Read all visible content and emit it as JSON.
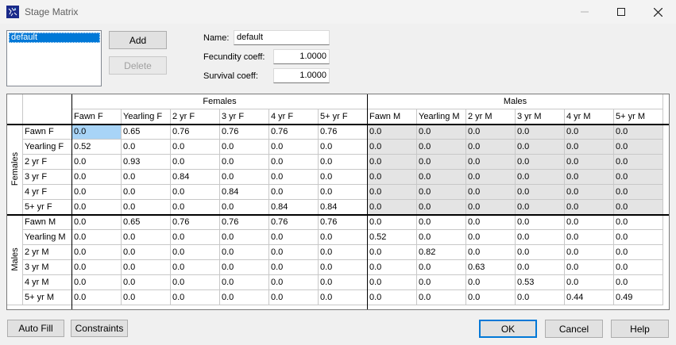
{
  "window": {
    "title": "Stage Matrix"
  },
  "stages_list": {
    "items": [
      "default"
    ]
  },
  "buttons": {
    "add": "Add",
    "delete": "Delete",
    "auto_fill": "Auto Fill",
    "constraints": "Constraints",
    "ok": "OK",
    "cancel": "Cancel",
    "help": "Help"
  },
  "fields": {
    "name_label": "Name:",
    "name_value": "default",
    "fecundity_label": "Fecundity coeff:",
    "fecundity_value": "1.0000",
    "survival_label": "Survival coeff:",
    "survival_value": "1.0000"
  },
  "matrix": {
    "group_headers": [
      "Females",
      "Males"
    ],
    "columns": [
      "Fawn F",
      "Yearling F",
      "2 yr F",
      "3 yr F",
      "4 yr F",
      "5+ yr F",
      "Fawn M",
      "Yearling M",
      "2 yr M",
      "3 yr M",
      "4 yr M",
      "5+ yr M"
    ],
    "row_groups": [
      "Females",
      "Males"
    ],
    "rows": [
      "Fawn F",
      "Yearling F",
      "2 yr F",
      "3 yr F",
      "4 yr F",
      "5+ yr F",
      "Fawn M",
      "Yearling M",
      "2 yr M",
      "3 yr M",
      "4 yr M",
      "5+ yr M"
    ],
    "values": [
      [
        "0.0",
        "0.65",
        "0.76",
        "0.76",
        "0.76",
        "0.76",
        "0.0",
        "0.0",
        "0.0",
        "0.0",
        "0.0",
        "0.0"
      ],
      [
        "0.52",
        "0.0",
        "0.0",
        "0.0",
        "0.0",
        "0.0",
        "0.0",
        "0.0",
        "0.0",
        "0.0",
        "0.0",
        "0.0"
      ],
      [
        "0.0",
        "0.93",
        "0.0",
        "0.0",
        "0.0",
        "0.0",
        "0.0",
        "0.0",
        "0.0",
        "0.0",
        "0.0",
        "0.0"
      ],
      [
        "0.0",
        "0.0",
        "0.84",
        "0.0",
        "0.0",
        "0.0",
        "0.0",
        "0.0",
        "0.0",
        "0.0",
        "0.0",
        "0.0"
      ],
      [
        "0.0",
        "0.0",
        "0.0",
        "0.84",
        "0.0",
        "0.0",
        "0.0",
        "0.0",
        "0.0",
        "0.0",
        "0.0",
        "0.0"
      ],
      [
        "0.0",
        "0.0",
        "0.0",
        "0.0",
        "0.84",
        "0.84",
        "0.0",
        "0.0",
        "0.0",
        "0.0",
        "0.0",
        "0.0"
      ],
      [
        "0.0",
        "0.65",
        "0.76",
        "0.76",
        "0.76",
        "0.76",
        "0.0",
        "0.0",
        "0.0",
        "0.0",
        "0.0",
        "0.0"
      ],
      [
        "0.0",
        "0.0",
        "0.0",
        "0.0",
        "0.0",
        "0.0",
        "0.52",
        "0.0",
        "0.0",
        "0.0",
        "0.0",
        "0.0"
      ],
      [
        "0.0",
        "0.0",
        "0.0",
        "0.0",
        "0.0",
        "0.0",
        "0.0",
        "0.82",
        "0.0",
        "0.0",
        "0.0",
        "0.0"
      ],
      [
        "0.0",
        "0.0",
        "0.0",
        "0.0",
        "0.0",
        "0.0",
        "0.0",
        "0.0",
        "0.63",
        "0.0",
        "0.0",
        "0.0"
      ],
      [
        "0.0",
        "0.0",
        "0.0",
        "0.0",
        "0.0",
        "0.0",
        "0.0",
        "0.0",
        "0.0",
        "0.53",
        "0.0",
        "0.0"
      ],
      [
        "0.0",
        "0.0",
        "0.0",
        "0.0",
        "0.0",
        "0.0",
        "0.0",
        "0.0",
        "0.0",
        "0.0",
        "0.44",
        "0.49"
      ]
    ]
  },
  "colors": {
    "selection": "#0078d7",
    "cell_selected": "#a8d4f7",
    "cell_disabled": "#e4e4e4"
  }
}
